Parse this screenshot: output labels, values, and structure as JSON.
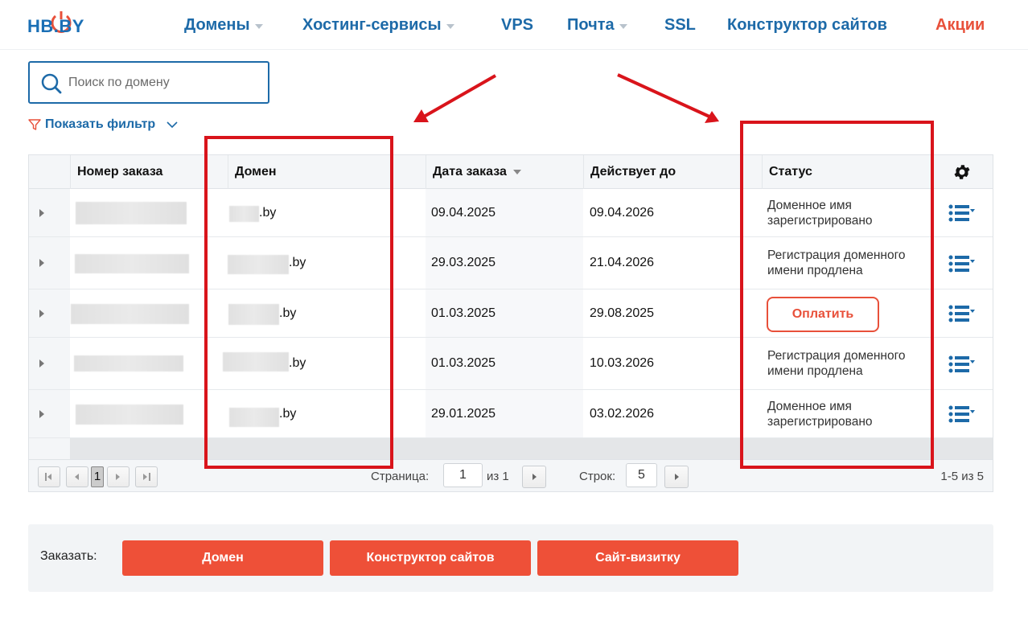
{
  "header": {
    "logo_text": "HB.BY",
    "nav": [
      {
        "label": "Домены",
        "dropdown": true
      },
      {
        "label": "Хостинг-сервисы",
        "dropdown": true
      },
      {
        "label": "VPS",
        "dropdown": false
      },
      {
        "label": "Почта",
        "dropdown": true
      },
      {
        "label": "SSL",
        "dropdown": false
      },
      {
        "label": "Конструктор сайтов",
        "dropdown": false
      },
      {
        "label": "Акции",
        "dropdown": false
      }
    ]
  },
  "search": {
    "placeholder": "Поиск по домену",
    "value": ""
  },
  "filter": {
    "label": "Показать фильтр"
  },
  "table": {
    "columns": [
      "Номер заказа",
      "Домен",
      "Дата заказа",
      "Действует до",
      "Статус"
    ],
    "sorted_column": "Дата заказа",
    "rows": [
      {
        "order": "",
        "domain": ".by",
        "order_date": "09.04.2025",
        "valid_until": "09.04.2026",
        "status": "Доменное имя зарегистрировано",
        "action": null
      },
      {
        "order": "",
        "domain": ".by",
        "order_date": "29.03.2025",
        "valid_until": "21.04.2026",
        "status": "Регистрация доменного имени продлена",
        "action": null
      },
      {
        "order": "",
        "domain": ".by",
        "order_date": "01.03.2025",
        "valid_until": "29.08.2025",
        "status": "",
        "action": "Оплатить"
      },
      {
        "order": "",
        "domain": ".by",
        "order_date": "01.03.2025",
        "valid_until": "10.03.2026",
        "status": "Регистрация доменного имени продлена",
        "action": null
      },
      {
        "order": "",
        "domain": ".by",
        "order_date": "29.01.2025",
        "valid_until": "03.02.2026",
        "status": "Доменное имя зарегистрировано",
        "action": null
      }
    ]
  },
  "pager": {
    "current_page": "1",
    "page_label": "Страница:",
    "page_value": "1",
    "of_label": "из 1",
    "rows_label": "Строк:",
    "rows_value": "5",
    "count": "1-5 из 5"
  },
  "order_bar": {
    "label": "Заказать:",
    "buttons": [
      "Домен",
      "Конструктор сайтов",
      "Сайт-визитку"
    ]
  },
  "colors": {
    "brand_blue": "#1d6aa8",
    "accent_red": "#ee5038",
    "annotation_red": "#d9141b"
  }
}
